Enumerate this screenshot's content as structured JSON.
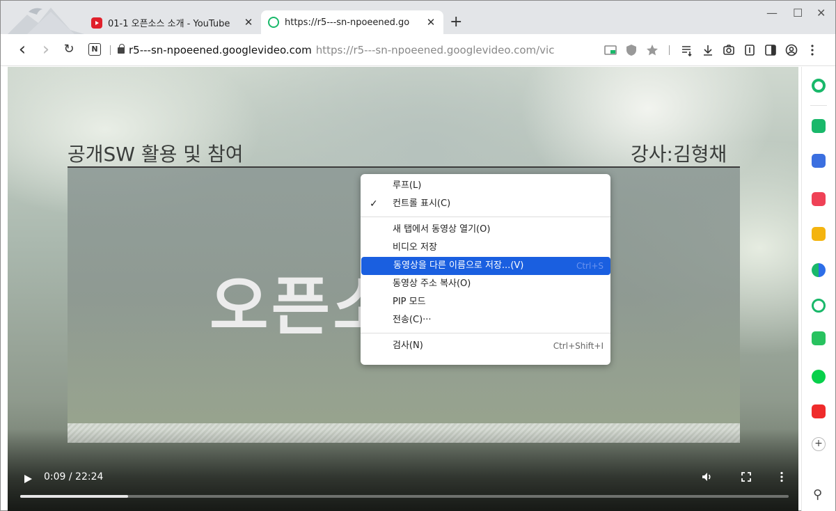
{
  "tabs": [
    {
      "title": "01-1 오픈소스 소개 - YouTube",
      "close": "✕",
      "favicon": "youtube-icon"
    },
    {
      "title": "https://r5---sn-npoeened.go",
      "close": "✕",
      "favicon": "whale-icon"
    }
  ],
  "new_tab_label": "+",
  "window_controls": {
    "minimize": "—",
    "maximize": "☐",
    "close": "✕"
  },
  "toolbar": {
    "back": "‹",
    "forward": "›",
    "reload": "↻",
    "n_label": "N",
    "url_host": "r5---sn-npoeened.googlevideo.com",
    "url_full": "https://r5---sn-npoeened.googlevideo.com/vic"
  },
  "video": {
    "slide_title_left": "공개SW 활용 및 참여",
    "slide_title_right": "강사:김형채",
    "slide_big_text": "오픈소",
    "time": "0:09 / 22:24",
    "progress_fraction": 0.0067
  },
  "context_menu": {
    "items": [
      {
        "label": "루프(L)",
        "shortcut": "",
        "checked": false
      },
      {
        "label": "컨트롤 표시(C)",
        "shortcut": "",
        "checked": true
      },
      {
        "label": "새 탭에서 동영상 열기(O)",
        "shortcut": "",
        "checked": false
      },
      {
        "label": "비디오 저장",
        "shortcut": "",
        "checked": false
      },
      {
        "label": "동영상을 다른 이름으로 저장...(V)",
        "shortcut": "Ctrl+S",
        "checked": false
      },
      {
        "label": "동영상 주소 복사(O)",
        "shortcut": "",
        "checked": false
      },
      {
        "label": "PIP 모드",
        "shortcut": "",
        "checked": false
      },
      {
        "label": "전송(C)···",
        "shortcut": "",
        "checked": false
      },
      {
        "label": "검사(N)",
        "shortcut": "Ctrl+Shift+I",
        "checked": false
      }
    ],
    "check_glyph": "✓"
  },
  "sidebar": {
    "plus": "+",
    "pin": "⚲"
  },
  "colors": {
    "accent": "#1a5fe0",
    "youtube_red": "#e0202b",
    "whale_green": "#19b86a"
  }
}
